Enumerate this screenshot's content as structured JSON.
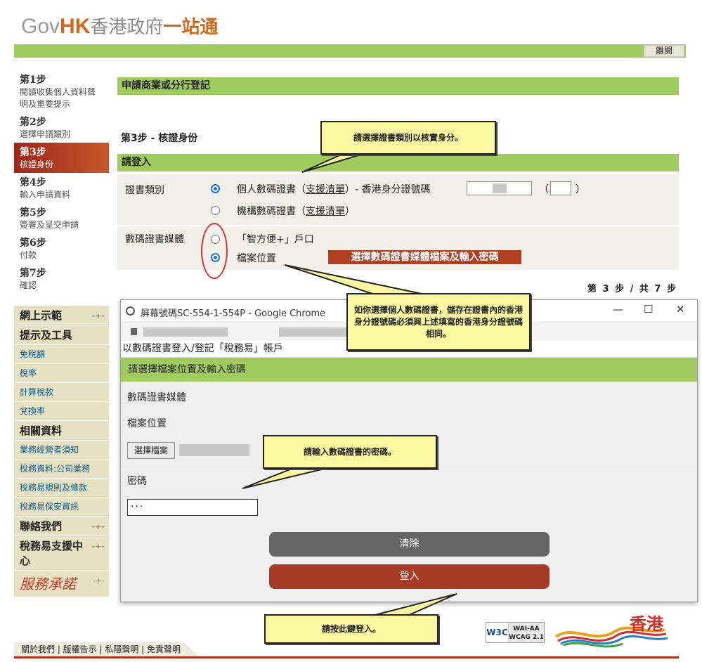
{
  "header": {
    "logo_gov": "Gov",
    "logo_hk": "HK",
    "logo_cn1": "香港政府",
    "logo_cn2": "一站通",
    "logout": "離開"
  },
  "steps": [
    {
      "num": "第1步",
      "desc": "閱讀收集個人資料聲明及重要提示"
    },
    {
      "num": "第2步",
      "desc": "選擇申請類別"
    },
    {
      "num": "第3步",
      "desc": "核證身份"
    },
    {
      "num": "第4步",
      "desc": "輸入申請資料"
    },
    {
      "num": "第5步",
      "desc": "簽署及呈交申請"
    },
    {
      "num": "第6步",
      "desc": "付款"
    },
    {
      "num": "第7步",
      "desc": "確認"
    }
  ],
  "menu": {
    "online_demo": "網上示範",
    "tips_tools": "提示及工具",
    "tax_free": "免稅額",
    "tax_rate": "稅率",
    "calc_tax": "計算稅款",
    "exchange": "兌換率",
    "related": "相關資料",
    "business_notes": "業務經營者須知",
    "tax_info": "稅務資料:公司業務",
    "etax_rules": "稅務易規則及條款",
    "etax_security": "稅務易保安資訊",
    "contact": "聯絡我們",
    "support": "稅務易支援中心",
    "brand_text": "服務承諾"
  },
  "main": {
    "title": "申請商業或分行登記",
    "step_title": "第3步  -  核證身份",
    "login_bar": "請登入",
    "cert_type_label": "證書類別",
    "personal_cert": "個人數碼證書",
    "support_list": "支援清單",
    "hkid_label": "香港身分證號碼",
    "org_cert": "機構數碼證書",
    "media_label": "數碼證書媒體",
    "iamsmart": "「智方便+」戶口",
    "file_location": "檔案位置",
    "red_banner": "選擇數碼證書媒體檔案及輸入密碼",
    "step_count": "第 3 步 / 共 7 步"
  },
  "popup": {
    "window_title": "屏幕號碼SC-554-1-554P - Google Chrome",
    "page_head": "以數碼證書登入/登記「稅務易」帳戶",
    "green_bar": "請選擇檔案位置及輸入密碼",
    "media_label": "數碼證書媒體",
    "file_location_label": "檔案位置",
    "choose_file": "選擇檔案",
    "password_label": "密碼",
    "password_value": "···",
    "clear_button": "清除",
    "login_button": "登入"
  },
  "callouts": {
    "c1": "請選擇證書類別以核實身分。",
    "c2": "如你選擇個人數碼證書，儲存在證書內的香港身分證號碼必須與上述填寫的香港身分證號碼相同。",
    "c3": "請輸入數碼證書的密碼。",
    "c4": "請按此鍵登入。"
  },
  "footer": {
    "links": "關於我們 | 版權告示 | 私隱聲明 | 免責聲明",
    "w3c": "W3C",
    "wcag_line1": "WAI-AA",
    "wcag_line2": "WCAG 2.1",
    "hk_brand": "香港"
  },
  "colors": {
    "green": "#9fcb5f",
    "active_step": "#a0261b",
    "login_button": "#a63a24",
    "callout": "#fbf7a1"
  }
}
